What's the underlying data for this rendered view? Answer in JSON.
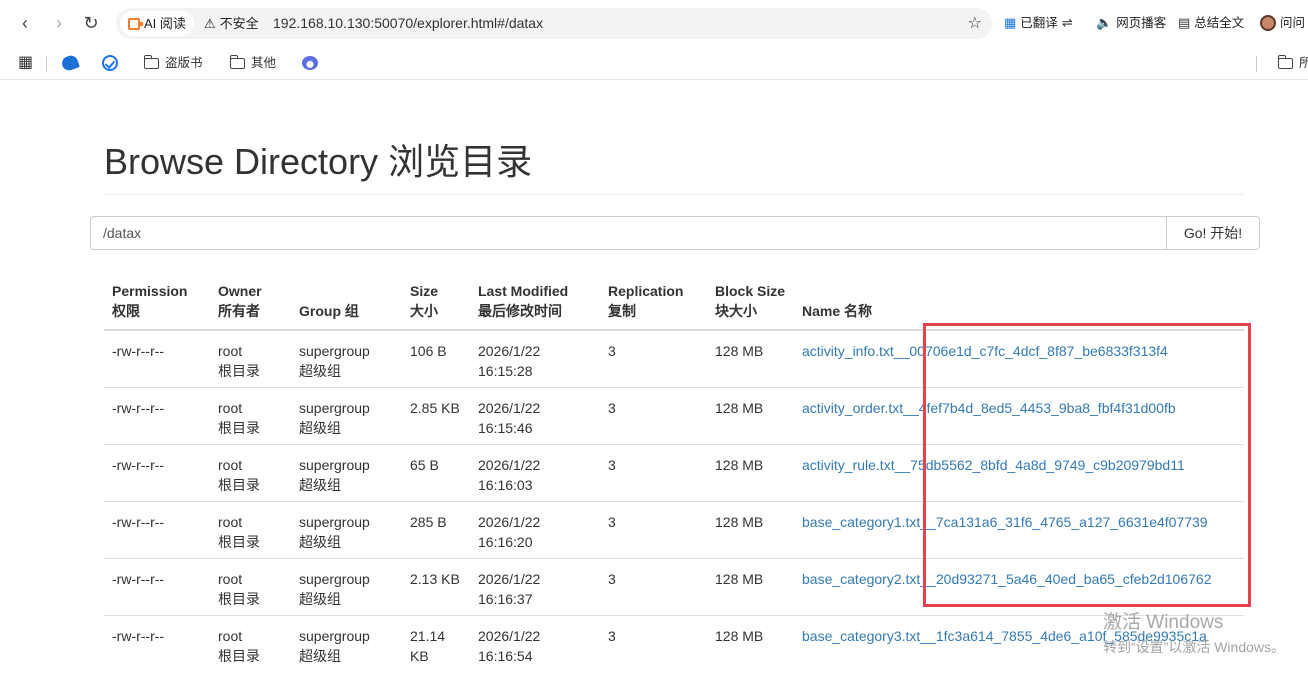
{
  "browser": {
    "ai_chip_label": "AI 阅读",
    "security_label": "不安全",
    "url": "192.168.10.130:50070/explorer.html#/datax",
    "extensions": {
      "translate": "已翻译",
      "read_aloud": "网页播客",
      "summary": "总结全文",
      "ask": "问问"
    },
    "bookmarks": [
      {
        "label": ""
      },
      {
        "label": ""
      },
      {
        "label": "盗版书"
      },
      {
        "label": "其他"
      },
      {
        "label": ""
      },
      {
        "label": "所"
      }
    ]
  },
  "page": {
    "title": "Browse Directory 浏览目录",
    "path_input_value": "/datax",
    "go_button": "Go! 开始!"
  },
  "table": {
    "headers": [
      {
        "en": "Permission",
        "zh": "权限"
      },
      {
        "en": "Owner",
        "zh": "所有者"
      },
      {
        "en": "Group 组",
        "zh": ""
      },
      {
        "en": "Size",
        "zh": "大小"
      },
      {
        "en": "Last Modified",
        "zh": "最后修改时间"
      },
      {
        "en": "Replication",
        "zh": "复制"
      },
      {
        "en": "Block Size",
        "zh": "块大小"
      },
      {
        "en": "Name 名称",
        "zh": ""
      }
    ],
    "rows": [
      {
        "permission": "-rw-r--r--",
        "owner": "root",
        "owner_zh": "根目录",
        "group": "supergroup",
        "group_zh": "超级组",
        "size": "106 B",
        "size_2": "",
        "date": "2026/1/22",
        "time": "16:15:28",
        "replication": "3",
        "block_size": "128 MB",
        "name": "activity_info.txt__00706e1d_c7fc_4dcf_8f87_be6833f313f4"
      },
      {
        "permission": "-rw-r--r--",
        "owner": "root",
        "owner_zh": "根目录",
        "group": "supergroup",
        "group_zh": "超级组",
        "size": "2.85 KB",
        "size_2": "",
        "date": "2026/1/22",
        "time": "16:15:46",
        "replication": "3",
        "block_size": "128 MB",
        "name": "activity_order.txt__4fef7b4d_8ed5_4453_9ba8_fbf4f31d00fb"
      },
      {
        "permission": "-rw-r--r--",
        "owner": "root",
        "owner_zh": "根目录",
        "group": "supergroup",
        "group_zh": "超级组",
        "size": "65 B",
        "size_2": "",
        "date": "2026/1/22",
        "time": "16:16:03",
        "replication": "3",
        "block_size": "128 MB",
        "name": "activity_rule.txt__75db5562_8bfd_4a8d_9749_c9b20979bd11"
      },
      {
        "permission": "-rw-r--r--",
        "owner": "root",
        "owner_zh": "根目录",
        "group": "supergroup",
        "group_zh": "超级组",
        "size": "285 B",
        "size_2": "",
        "date": "2026/1/22",
        "time": "16:16:20",
        "replication": "3",
        "block_size": "128 MB",
        "name": "base_category1.txt__7ca131a6_31f6_4765_a127_6631e4f07739"
      },
      {
        "permission": "-rw-r--r--",
        "owner": "root",
        "owner_zh": "根目录",
        "group": "supergroup",
        "group_zh": "超级组",
        "size": "2.13 KB",
        "size_2": "",
        "date": "2026/1/22",
        "time": "16:16:37",
        "replication": "3",
        "block_size": "128 MB",
        "name": "base_category2.txt__20d93271_5a46_40ed_ba65_cfeb2d106762"
      },
      {
        "permission": "-rw-r--r--",
        "owner": "root",
        "owner_zh": "根目录",
        "group": "supergroup",
        "group_zh": "超级组",
        "size": "21.14",
        "size_2": "KB",
        "date": "2026/1/22",
        "time": "16:16:54",
        "replication": "3",
        "block_size": "128 MB",
        "name": "base_category3.txt__1fc3a614_7855_4de6_a10f_585de9935c1a"
      }
    ]
  },
  "watermark": {
    "line1": "激活 Windows",
    "line2": "转到“设置”以激活 Windows。"
  },
  "colors": {
    "link": "#337ab7",
    "highlight_border": "#e8424e"
  }
}
